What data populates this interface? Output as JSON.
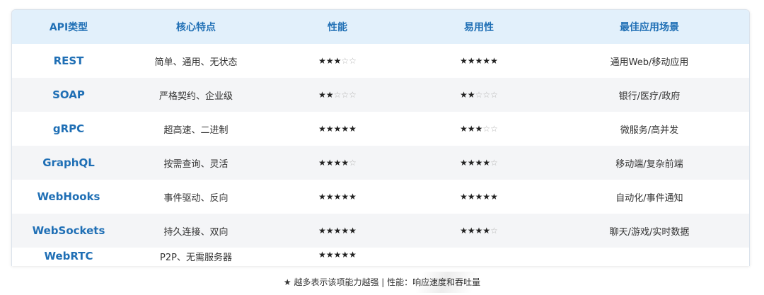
{
  "table": {
    "headers": [
      "API类型",
      "核心特点",
      "性能",
      "易用性",
      "最佳应用场景"
    ],
    "rows": [
      {
        "name": "REST",
        "feature": "简单、通用、无状态",
        "performance": 3,
        "ease": 5,
        "scenario": "通用Web/移动应用"
      },
      {
        "name": "SOAP",
        "feature": "严格契约、企业级",
        "performance": 2,
        "ease": 2,
        "scenario": "银行/医疗/政府"
      },
      {
        "name": "gRPC",
        "feature": "超高速、二进制",
        "performance": 5,
        "ease": 3,
        "scenario": "微服务/高并发"
      },
      {
        "name": "GraphQL",
        "feature": "按需查询、灵活",
        "performance": 4,
        "ease": 4,
        "scenario": "移动端/复杂前端"
      },
      {
        "name": "WebHooks",
        "feature": "事件驱动、反向",
        "performance": 5,
        "ease": 5,
        "scenario": "自动化/事件通知"
      },
      {
        "name": "WebSockets",
        "feature": "持久连接、双向",
        "performance": 5,
        "ease": 4,
        "scenario": "聊天/游戏/实时数据"
      },
      {
        "name": "WebRTC",
        "feature": "P2P、无需服务器",
        "performance": 5,
        "ease": null,
        "scenario": ""
      }
    ],
    "max_stars": 5
  },
  "footnote": "★ 越多表示该项能力越强 | 性能：响应速度和吞吐量",
  "colors": {
    "header_bg": "#e2f0fb",
    "accent": "#1f6fb5",
    "alt_row": "#f4f5f7"
  }
}
